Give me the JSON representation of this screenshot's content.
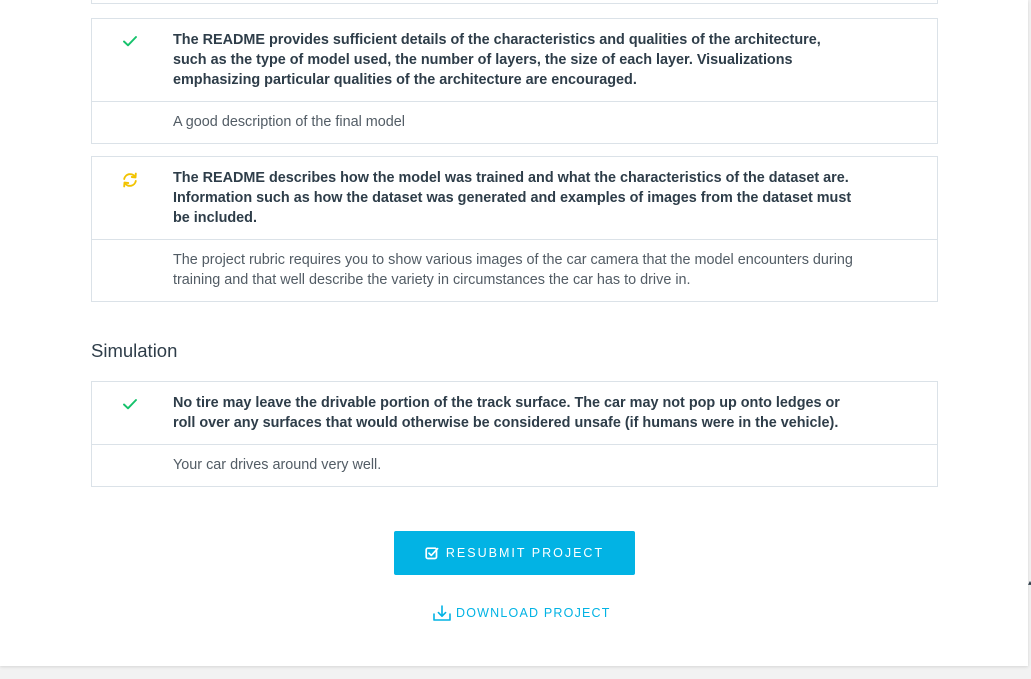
{
  "review": {
    "items": [
      {
        "status": "passed",
        "requirement": "The README provides sufficient details of the characteristics and qualities of the architecture, such as the type of model used, the number of layers, the size of each layer. Visualizations emphasizing particular qualities of the architecture are encouraged.",
        "comment": "A good description of the final model"
      },
      {
        "status": "requires-changes",
        "requirement": "The README describes how the model was trained and what the characteristics of the dataset are. Information such as how the dataset was generated and examples of images from the dataset must be included.",
        "comment": "The project rubric requires you to show various images of the car camera that the model encounters during training and that well describe the variety in circumstances the car has to drive in."
      }
    ]
  },
  "simulation": {
    "title": "Simulation",
    "items": [
      {
        "status": "passed",
        "requirement": "No tire may leave the drivable portion of the track surface. The car may not pop up onto ledges or roll over any surfaces that would otherwise be considered unsafe (if humans were in the vehicle).",
        "comment": "Your car drives around very well."
      }
    ]
  },
  "actions": {
    "resubmit_label": "RESUBMIT PROJECT",
    "download_label": "DOWNLOAD PROJECT"
  },
  "colors": {
    "accent": "#02b3e4",
    "passed": "#15c26b",
    "requires_changes": "#f2c300"
  }
}
